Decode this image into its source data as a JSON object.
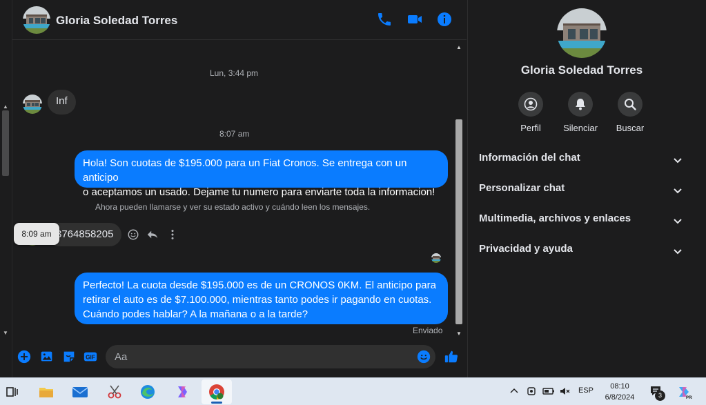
{
  "contact": {
    "name": "Gloria Soledad Torres"
  },
  "header": {
    "call_icon": "phone-icon",
    "video_icon": "video-camera-icon",
    "info_icon": "info-icon"
  },
  "messages": {
    "timestamp_1": "Lun, 3:44 pm",
    "in_1": "Inf",
    "timestamp_2": "8:07 am",
    "out_1_line1": "Hola! Son cuotas de $195.000 para un Fiat Cronos. Se entrega con un anticipo",
    "out_1_line2": "o aceptamos un usado. Dejame tu numero para enviarte toda la informacion!",
    "system_note": "Ahora pueden llamarse y ver su estado activo y cuándo leen los mensajes.",
    "tooltip_time": "8:09 am",
    "in_2": "3764858205",
    "out_2_line1": "Perfecto! La cuota desde $195.000 es de un CRONOS 0KM. El anticipo para",
    "out_2_line2": "retirar el auto es de $7.100.000, mientras tanto podes ir pagando en cuotas.",
    "out_2_line3": "Cuándo podes hablar? A la mañana o a la tarde?",
    "status": "Enviado"
  },
  "composer": {
    "placeholder": "Aa"
  },
  "info_panel": {
    "name": "Gloria Soledad Torres",
    "actions": [
      {
        "label": "Perfil",
        "icon": "profile-icon"
      },
      {
        "label": "Silenciar",
        "icon": "bell-icon"
      },
      {
        "label": "Buscar",
        "icon": "search-icon"
      }
    ],
    "sections": [
      "Información del chat",
      "Personalizar chat",
      "Multimedia, archivos y enlaces",
      "Privacidad y ayuda"
    ]
  },
  "taskbar": {
    "lang": "ESP",
    "time": "08:10",
    "date": "6/8/2024",
    "notification_count": "3"
  },
  "colors": {
    "accent": "#0a7cff",
    "background": "#1c1c1d",
    "bubble_in": "#303030"
  }
}
